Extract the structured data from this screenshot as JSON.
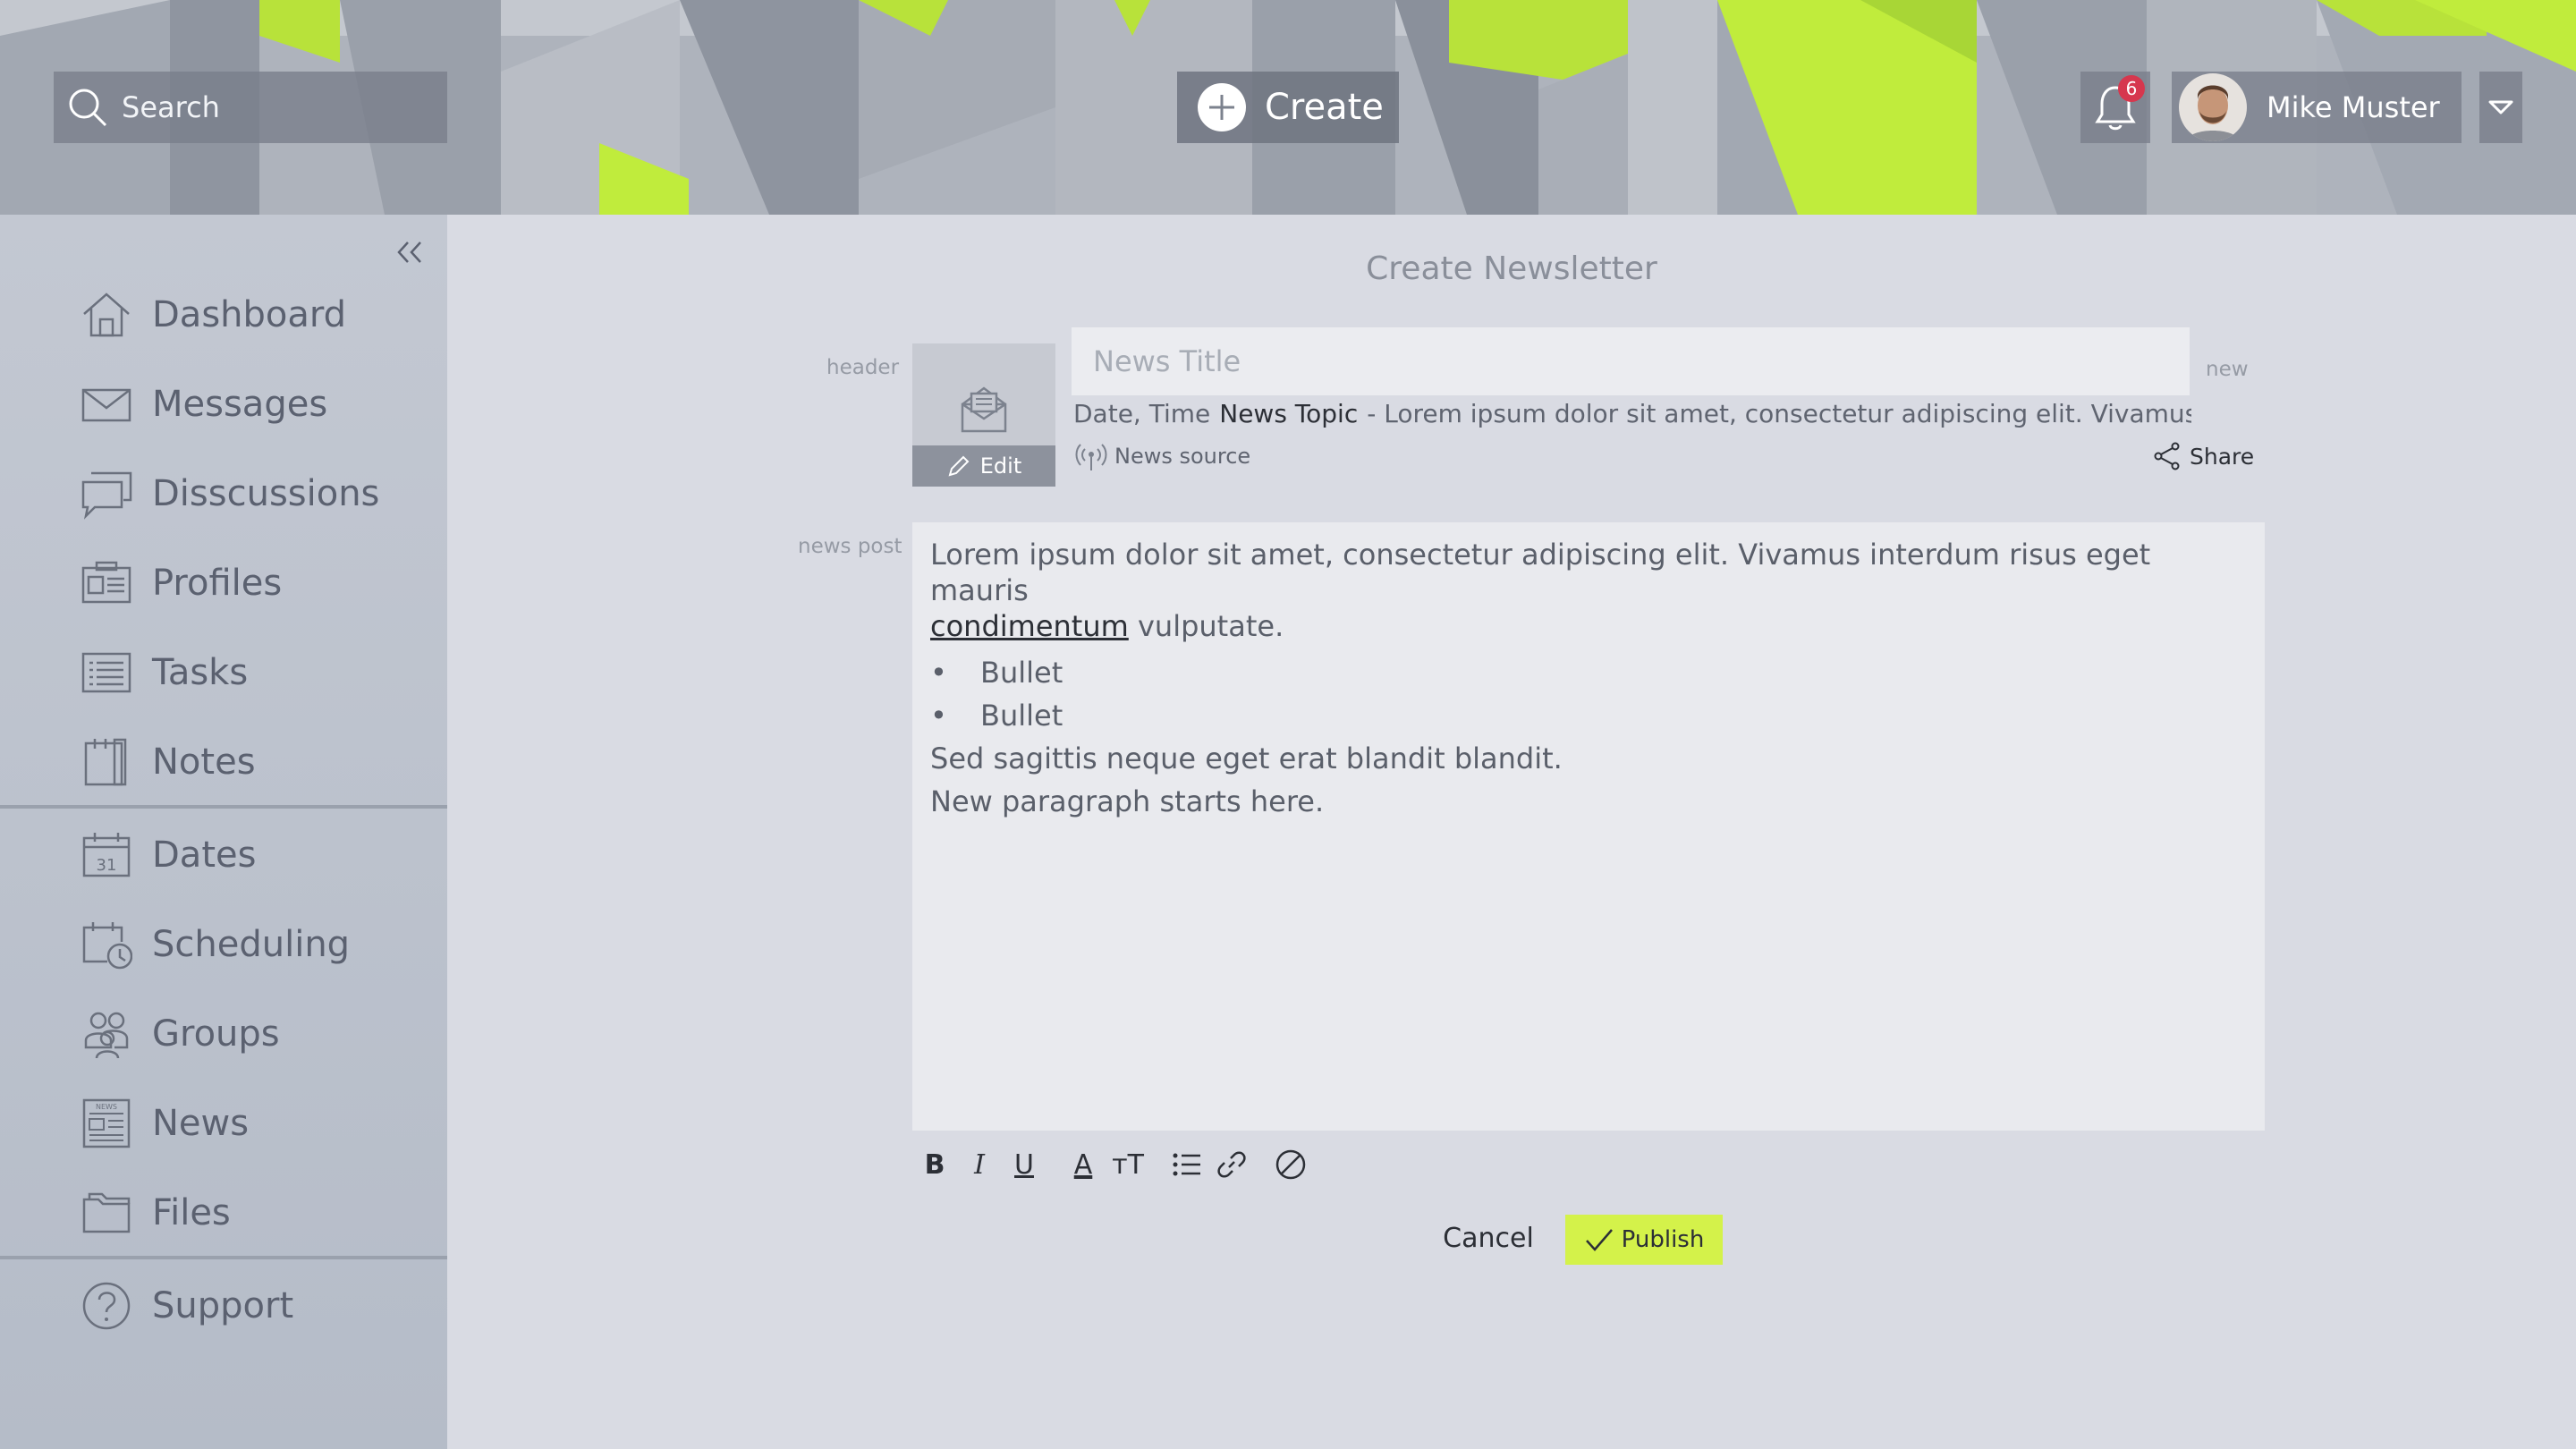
{
  "header": {
    "search_placeholder": "Search",
    "create_label": "Create",
    "notification_count": "6",
    "user_name": "Mike Muster"
  },
  "sidebar": {
    "group1": [
      {
        "label": "Dashboard",
        "icon": "home-icon"
      },
      {
        "label": "Messages",
        "icon": "mail-icon"
      },
      {
        "label": "Disscussions",
        "icon": "chat-icon"
      },
      {
        "label": "Profiles",
        "icon": "profile-card-icon"
      },
      {
        "label": "Tasks",
        "icon": "list-icon"
      },
      {
        "label": "Notes",
        "icon": "notes-icon"
      }
    ],
    "group2": [
      {
        "label": "Dates",
        "icon": "calendar-icon"
      },
      {
        "label": "Scheduling",
        "icon": "schedule-icon"
      },
      {
        "label": "Groups",
        "icon": "groups-icon"
      },
      {
        "label": "News",
        "icon": "news-icon"
      },
      {
        "label": "Files",
        "icon": "folder-icon"
      }
    ],
    "group3": [
      {
        "label": "Support",
        "icon": "help-icon"
      }
    ],
    "calendar_day": "31",
    "news_icon_text": "NEWS"
  },
  "main": {
    "page_title": "Create Newsletter",
    "header_label": "header",
    "new_label": "new",
    "news_post_label": "news post",
    "edit_label": "Edit",
    "title_placeholder": "News Title",
    "date_time": "Date, Time",
    "news_topic": "News Topic",
    "summary": "- Lorem ipsum dolor sit amet, consectetur adipiscing elit. Vivamus ...",
    "news_source": "News source",
    "share_label": "Share",
    "body": {
      "para1_start": "Lorem ipsum dolor sit amet, consectetur adipiscing elit. Vivamus interdum risus eget mauris",
      "link_text": "condimentum",
      "para1_end": " vulputate.",
      "bullets": [
        "Bullet",
        "Bullet"
      ],
      "bullet_char": "•",
      "para2": "Sed sagittis neque eget erat blandit blandit.",
      "para3": "New paragraph starts here."
    },
    "toolbar": {
      "bold": "B",
      "italic": "I",
      "underline": "U",
      "font_color": "A",
      "font_size": "тT"
    },
    "cancel_label": "Cancel",
    "publish_label": "Publish"
  },
  "colors": {
    "accent": "#d4f24a",
    "badge": "#d6374e",
    "sidebar_text": "#5b6170"
  }
}
